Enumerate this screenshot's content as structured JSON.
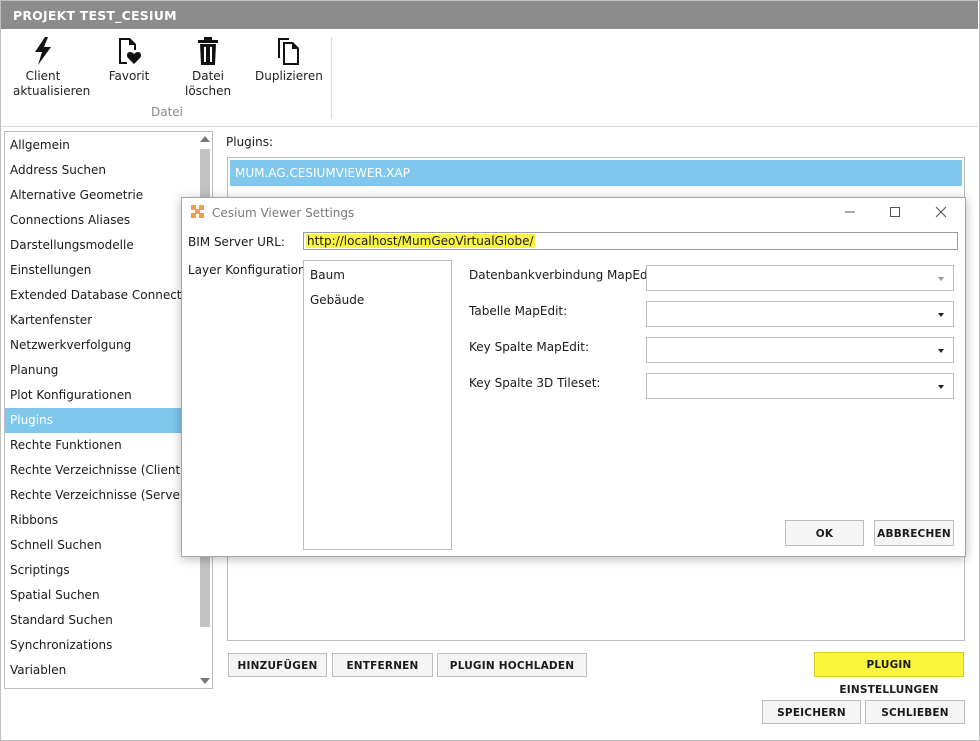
{
  "window": {
    "title": "PROJEKT TEST_CESIUM"
  },
  "ribbon": {
    "buttons": [
      {
        "line1": "Client",
        "line2": "aktualisieren",
        "icon": "lightning-icon"
      },
      {
        "line1": "Favorit",
        "line2": "",
        "icon": "favorite-document-icon"
      },
      {
        "line1": "Datei",
        "line2": "löschen",
        "icon": "trash-icon"
      },
      {
        "line1": "Duplizieren",
        "line2": "",
        "icon": "duplicate-icon"
      }
    ],
    "group_label": "Datei"
  },
  "sidebar": {
    "selected": "Plugins",
    "items": [
      "Allgemein",
      "Address Suchen",
      "Alternative Geometrie",
      "Connections Aliases",
      "Darstellungsmodelle",
      "Einstellungen",
      "Extended Database Connections",
      "Kartenfenster",
      "Netzwerkverfolgung",
      "Planung",
      "Plot Konfigurationen",
      "Plugins",
      "Rechte Funktionen",
      "Rechte Verzeichnisse (Client)",
      "Rechte Verzeichnisse (Server)",
      "Ribbons",
      "Schnell Suchen",
      "Scriptings",
      "Spatial Suchen",
      "Standard Suchen",
      "Synchronizations",
      "Variablen"
    ]
  },
  "plugins": {
    "label": "Plugins:",
    "items": [
      "MUM.AG.CESIUMVIEWER.XAP"
    ]
  },
  "plugin_buttons": {
    "add": "HINZUFÜGEN",
    "remove": "ENTFERNEN",
    "upload": "PLUGIN HOCHLADEN",
    "settings": "PLUGIN EINSTELLUNGEN"
  },
  "footer_buttons": {
    "save": "SPEICHERN",
    "close": "SCHLIEBEN"
  },
  "dialog": {
    "title": "Cesium Viewer Settings",
    "bim_label": "BIM Server URL:",
    "bim_value": "http://localhost/MumGeoVirtualGlobe/",
    "layer_label": "Layer Konfiguration:",
    "layers": [
      "Baum",
      "Gebäude"
    ],
    "fields": [
      {
        "label": "Datenbankverbindung MapEdit:",
        "value": ""
      },
      {
        "label": "Tabelle MapEdit:",
        "value": ""
      },
      {
        "label": "Key Spalte MapEdit:",
        "value": ""
      },
      {
        "label": "Key Spalte 3D Tileset:",
        "value": ""
      }
    ],
    "ok": "OK",
    "cancel": "ABBRECHEN"
  },
  "colors": {
    "selection": "#7fc7ec",
    "highlight_yellow": "#f9f43c",
    "titlebar": "#8c8c8c",
    "logo_orange": "#f0a040"
  }
}
